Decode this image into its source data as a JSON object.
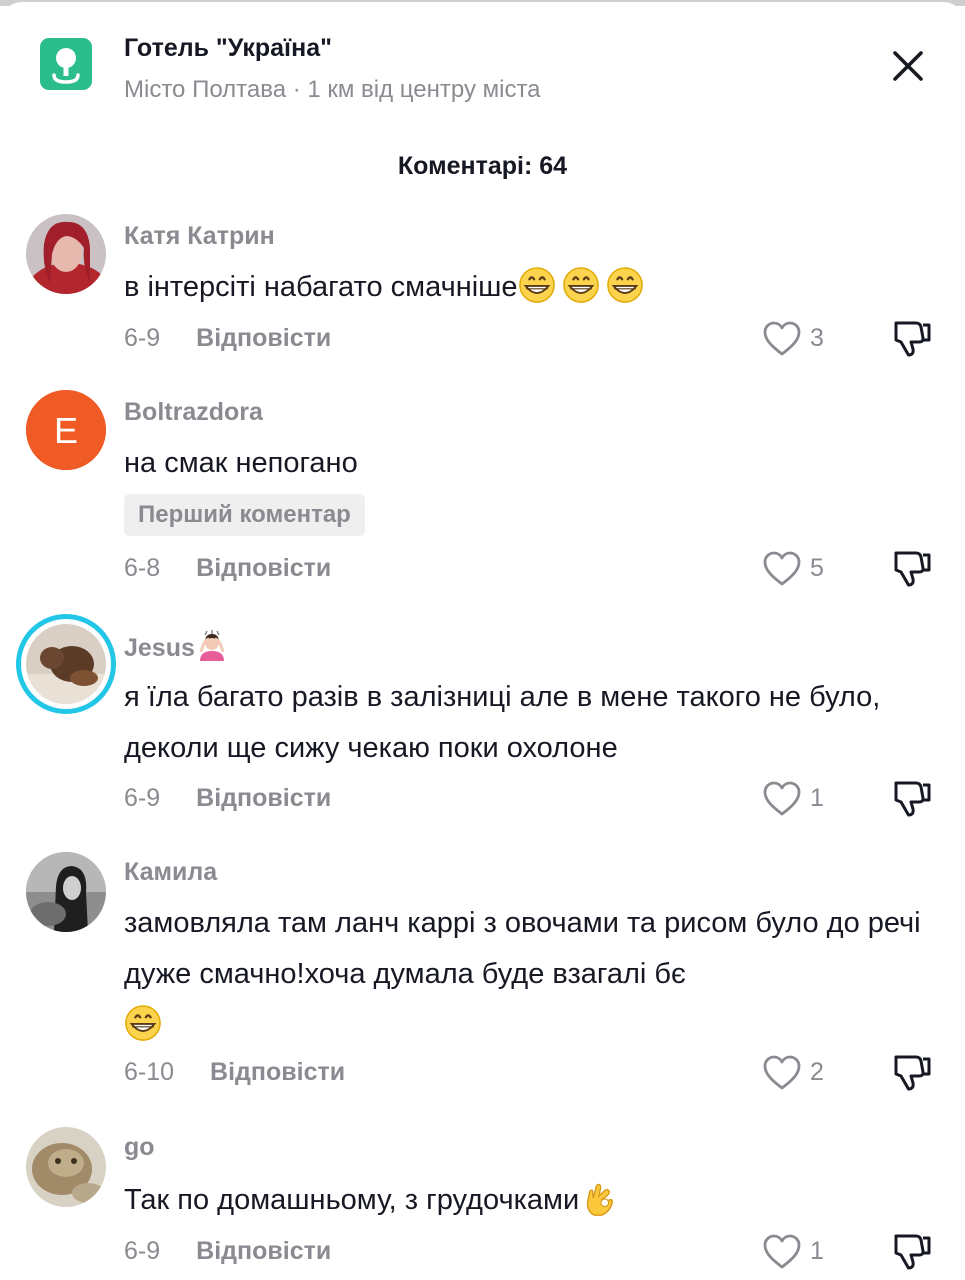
{
  "location": {
    "icon": "map-pin-icon",
    "title": "Готель \"Україна\"",
    "subtitle": "Місто Полтава · 1 км від центру міста",
    "accent_color": "#2bbd8c"
  },
  "close_icon": "close-icon",
  "comments_header": "Коментарі: 64",
  "reply_label": "Відповісти",
  "comments": [
    {
      "username": "Катя Катрин",
      "text": "в інтерсіті набагато смачніше",
      "emoji": [
        "grinning-face-emoji",
        "grinning-face-emoji",
        "grinning-face-emoji"
      ],
      "date": "6-9",
      "likes": "3"
    },
    {
      "username": "Boltrazdora",
      "avatar_letter": "E",
      "avatar_color": "#f05a24",
      "text": "на смак непогано",
      "badge": "Перший коментар",
      "date": "6-8",
      "likes": "5"
    },
    {
      "username": "Jesus",
      "username_emoji": "woman-gesturing-ok-emoji",
      "text": "я їла багато разів в залізниці але в мене такого не було, деколи ще сижу чекаю поки охолоне",
      "date": "6-9",
      "likes": "1"
    },
    {
      "username": "Камила",
      "text": "замовляла там ланч каррі з овочами та рисом було до речі дуже смачно!хоча думала буде взагалі бє",
      "emoji": [
        "grinning-face-emoji"
      ],
      "date": "6-10",
      "likes": "2"
    },
    {
      "username": "go",
      "text": "Так по домашньому, з грудочками",
      "emoji": [
        "ok-hand-emoji"
      ],
      "date": "6-9",
      "likes": "1"
    }
  ]
}
